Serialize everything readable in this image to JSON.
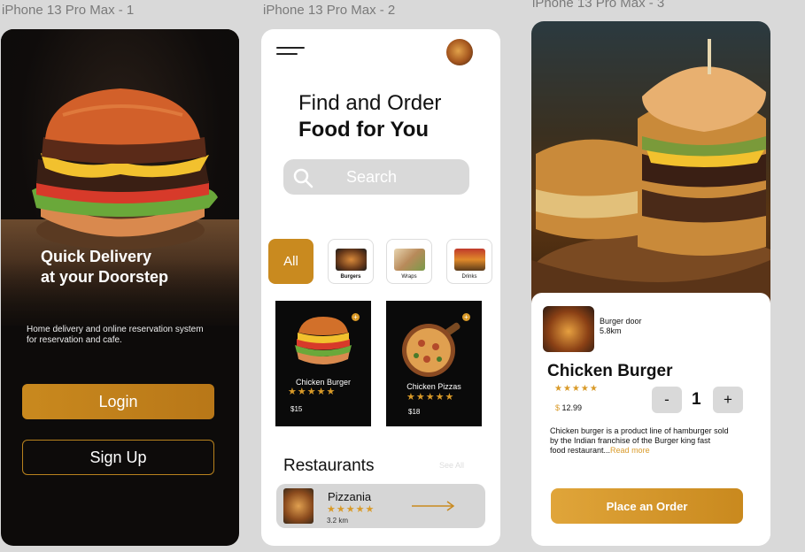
{
  "frames": {
    "frame1_title": "iPhone 13 Pro Max - 1",
    "frame2_title": "iPhone 13 Pro Max - 2",
    "frame3_title": "iPhone 13 Pro Max - 3"
  },
  "screen1": {
    "headline_line1": "Quick Delivery",
    "headline_line2": "at your Doorstep",
    "description_line1": "Home delivery and online reservation system",
    "description_line2": "for reservation and cafe.",
    "login_label": "Login",
    "signup_label": "Sign Up"
  },
  "screen2": {
    "title_line1": "Find and Order",
    "title_line2": "Food for You",
    "search_placeholder": "Search",
    "categories": [
      {
        "label": "All"
      },
      {
        "label": "Burgers"
      },
      {
        "label": "Wraps"
      },
      {
        "label": "Drinks"
      }
    ],
    "items": [
      {
        "name": "Chicken Burger",
        "stars": "★★★★★",
        "price": "$15"
      },
      {
        "name": "Chicken Pizzas",
        "stars": "★★★★★",
        "price": "$18"
      }
    ],
    "restaurants_heading": "Restaurants",
    "see_all": "See All",
    "restaurant": {
      "name": "Pizzania",
      "stars": "★★★★★",
      "distance": "3.2 km"
    }
  },
  "screen3": {
    "shop_name": "Burger door",
    "shop_distance": "5.8km",
    "product_title": "Chicken Burger",
    "stars": "★★★★★",
    "price_symbol": "$",
    "price_value": "12.99",
    "qty_minus": "-",
    "qty_value": "1",
    "qty_plus": "+",
    "description_line1": "Chicken burger is a product line of hamburger sold",
    "description_line2": "by the Indian franchise of  the Burger king fast",
    "description_line3": "food restaurant...",
    "read_more": "Read more",
    "order_label": "Place an Order"
  },
  "colors": {
    "accent": "#c98a1f",
    "dark": "#0d0b0a",
    "light_gray": "#d9d9d9"
  },
  "icons": [
    "menu-icon",
    "search-icon",
    "plus-icon",
    "arrow-right-icon",
    "star-icon"
  ]
}
